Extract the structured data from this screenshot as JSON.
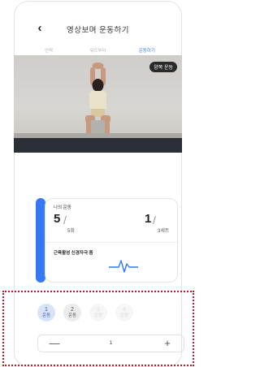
{
  "header": {
    "back_icon": "chevron-left-icon",
    "title": "영상보며 운동하기",
    "tabs": [
      {
        "label": "안락",
        "active": false
      },
      {
        "label": "워드부터",
        "active": false
      },
      {
        "label": "운동하기",
        "active": true
      }
    ]
  },
  "video": {
    "badge": "양쪽 운동"
  },
  "exercise_card": {
    "label": "나의 운동",
    "reps_current": "5",
    "reps_unit": "5회",
    "sets_current": "1",
    "sets_unit": "3세트",
    "status_label": "근육활성 신경자극 중",
    "status_icon": "pulse-wave-icon",
    "accent_color": "#3478f6"
  },
  "set_selector": {
    "sets": [
      {
        "number": "1",
        "label": "운동",
        "state": "current"
      },
      {
        "number": "2",
        "label": "운동",
        "state": "done"
      },
      {
        "number": "3",
        "label": "운동",
        "state": "todo"
      },
      {
        "number": "4",
        "label": "운동",
        "state": "todo"
      }
    ]
  },
  "stepper": {
    "minus": "—",
    "value": "1",
    "plus": "+"
  },
  "highlight_color": "#c4142c"
}
